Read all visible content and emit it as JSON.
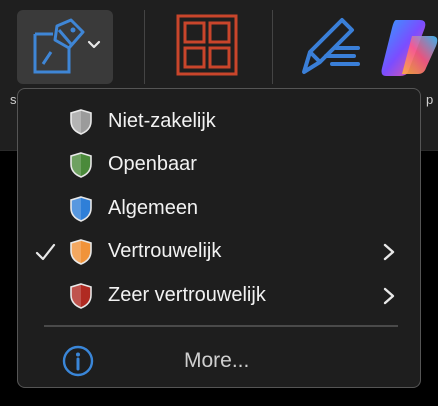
{
  "toolbar": {
    "sensitivity_button": {
      "icon": "sensitivity-icon",
      "dropdown_icon": "chevron-down-icon"
    },
    "layout_icon": "grid-icon",
    "editor_icon": "editor-pen-icon",
    "copilot_icon": "copilot-icon"
  },
  "menu": {
    "items": [
      {
        "label": "Niet-zakelijk",
        "shield_color": "#9b9b9b",
        "checked": false,
        "submenu": false
      },
      {
        "label": "Openbaar",
        "shield_color": "#4a8a3a",
        "checked": false,
        "submenu": false
      },
      {
        "label": "Algemeen",
        "shield_color": "#2f7fd8",
        "checked": false,
        "submenu": false
      },
      {
        "label": "Vertrouwelijk",
        "shield_color": "#f0933a",
        "checked": true,
        "submenu": true
      },
      {
        "label": "Zeer vertrouwelijk",
        "shield_color": "#b02a22",
        "checked": false,
        "submenu": true
      }
    ],
    "more_label": "More..."
  },
  "colors": {
    "accent": "#3a86d8",
    "menu_bg": "#1e1e1e",
    "toolbar_bg": "#1f1f1f"
  }
}
